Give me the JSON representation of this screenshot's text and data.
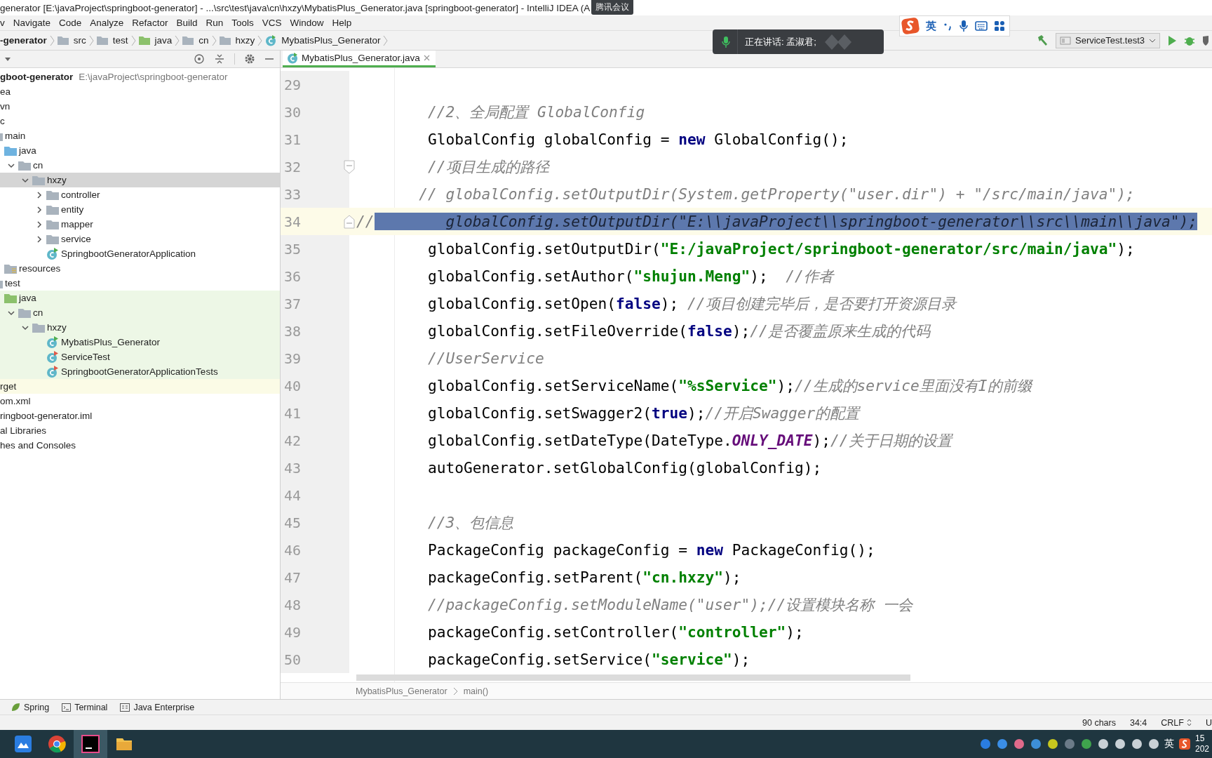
{
  "window": {
    "title": "generator [E:\\javaProject\\springboot-generator] - ...\\src\\test\\java\\cn\\hxzy\\MybatisPlus_Generator.java [springboot-generator] - IntelliJ IDEA (A",
    "overlay_badge": "腾讯会议"
  },
  "menu": [
    "v",
    "Navigate",
    "Code",
    "Analyze",
    "Refactor",
    "Build",
    "Run",
    "Tools",
    "VCS",
    "Window",
    "Help"
  ],
  "navigation_bar": {
    "items": [
      {
        "label": "-generator",
        "kind": "module"
      },
      {
        "label": "src",
        "kind": "folder"
      },
      {
        "label": "test",
        "kind": "folder"
      },
      {
        "label": "java",
        "kind": "test-root"
      },
      {
        "label": "cn",
        "kind": "package"
      },
      {
        "label": "hxzy",
        "kind": "package"
      },
      {
        "label": "MybatisPlus_Generator",
        "kind": "runnable-class"
      }
    ],
    "run_configuration": "ServiceTest.test3"
  },
  "meeting_toast": {
    "text": "正在讲话: 孟淑君;"
  },
  "input_method_bar": {
    "mode": "英"
  },
  "project_tree": {
    "items": [
      {
        "label": "gboot-generator",
        "path": "E:\\javaProject\\springboot-generator",
        "kind": "project",
        "selected": false,
        "children": [
          {
            "label": "ea",
            "kind": "folder",
            "selected": false
          },
          {
            "label": "vn",
            "kind": "folder",
            "selected": false
          },
          {
            "label": "c",
            "kind": "folder",
            "selected": false,
            "children": [
              {
                "label": "main",
                "kind": "folder",
                "selected": false,
                "children": [
                  {
                    "label": "java",
                    "kind": "source-root",
                    "selected": false,
                    "children": [
                      {
                        "label": "cn",
                        "kind": "package",
                        "expanded": true,
                        "selected": false,
                        "children": [
                          {
                            "label": "hxzy",
                            "kind": "package",
                            "expanded": true,
                            "selected": true,
                            "children": [
                              {
                                "label": "controller",
                                "kind": "package",
                                "expanded": false,
                                "selected": false
                              },
                              {
                                "label": "entity",
                                "kind": "package",
                                "expanded": false,
                                "selected": false
                              },
                              {
                                "label": "mapper",
                                "kind": "package",
                                "expanded": false,
                                "selected": false
                              },
                              {
                                "label": "service",
                                "kind": "package",
                                "expanded": false,
                                "selected": false
                              },
                              {
                                "label": "SpringbootGeneratorApplication",
                                "kind": "app-class",
                                "selected": false
                              }
                            ]
                          }
                        ]
                      }
                    ]
                  },
                  {
                    "label": "resources",
                    "kind": "resources-root",
                    "selected": false
                  }
                ]
              },
              {
                "label": "test",
                "kind": "folder",
                "selected": false,
                "children": [
                  {
                    "label": "java",
                    "kind": "test-root",
                    "selected": false,
                    "children": [
                      {
                        "label": "cn",
                        "kind": "package",
                        "expanded": true,
                        "selected": false,
                        "children": [
                          {
                            "label": "hxzy",
                            "kind": "package",
                            "expanded": true,
                            "selected": false,
                            "children": [
                              {
                                "label": "MybatisPlus_Generator",
                                "kind": "runnable-class",
                                "selected": false
                              },
                              {
                                "label": "ServiceTest",
                                "kind": "test-class",
                                "selected": false
                              },
                              {
                                "label": "SpringbootGeneratorApplicationTests",
                                "kind": "test-class",
                                "selected": false
                              }
                            ]
                          }
                        ]
                      }
                    ]
                  }
                ]
              }
            ]
          },
          {
            "label": "rget",
            "kind": "excluded-folder",
            "selected": false
          },
          {
            "label": "om.xml",
            "kind": "file",
            "selected": false
          },
          {
            "label": "ringboot-generator.iml",
            "kind": "file",
            "selected": false
          }
        ]
      },
      {
        "label": "al Libraries",
        "kind": "library",
        "selected": false
      },
      {
        "label": "hes and Consoles",
        "kind": "scratches",
        "selected": false
      }
    ]
  },
  "editor": {
    "tab": {
      "label": "MybatisPlus_Generator.java",
      "selected": true
    },
    "lines": [
      {
        "number": "29",
        "selected": false
      },
      {
        "number": "30",
        "selected": false,
        "segments": [
          {
            "text": "        //2、全局配置 GlobalConfig",
            "kind": "comment"
          }
        ]
      },
      {
        "number": "31",
        "selected": false,
        "segments": [
          {
            "text": "        GlobalConfig globalConfig = ",
            "kind": "plain"
          },
          {
            "text": "new",
            "kind": "keyword"
          },
          {
            "text": " GlobalConfig();",
            "kind": "plain"
          }
        ]
      },
      {
        "number": "32",
        "selected": false,
        "fold_start": true,
        "segments": [
          {
            "text": "        //项目生成的路径",
            "kind": "comment"
          }
        ]
      },
      {
        "number": "33",
        "selected": false,
        "segments": [
          {
            "text": "       // globalConfig.setOutputDir(System.getProperty(\"user.dir\") + \"/src/main/java\");",
            "kind": "comment"
          }
        ]
      },
      {
        "number": "34",
        "selected": true,
        "fold_end": true,
        "segments": [
          {
            "text": "//",
            "kind": "comment"
          },
          {
            "text": "        globalConfig.setOutputDir(\"E:\\\\javaProject\\\\springboot-generator\\\\src\\\\main\\\\java\");",
            "kind": "comment"
          }
        ]
      },
      {
        "number": "35",
        "selected": false,
        "segments": [
          {
            "text": "        globalConfig.setOutputDir(",
            "kind": "plain"
          },
          {
            "text": "\"E:/javaProject/springboot-generator/src/main/java\"",
            "kind": "string"
          },
          {
            "text": ");",
            "kind": "plain"
          }
        ]
      },
      {
        "number": "36",
        "selected": false,
        "segments": [
          {
            "text": "        globalConfig.setAuthor(",
            "kind": "plain"
          },
          {
            "text": "\"shujun.Meng\"",
            "kind": "string"
          },
          {
            "text": ");  ",
            "kind": "plain"
          },
          {
            "text": "//作者",
            "kind": "comment"
          }
        ]
      },
      {
        "number": "37",
        "selected": false,
        "segments": [
          {
            "text": "        globalConfig.setOpen(",
            "kind": "plain"
          },
          {
            "text": "false",
            "kind": "keyword"
          },
          {
            "text": "); ",
            "kind": "plain"
          },
          {
            "text": "//项目创建完毕后，是否要打开资源目录",
            "kind": "comment"
          }
        ]
      },
      {
        "number": "38",
        "selected": false,
        "segments": [
          {
            "text": "        globalConfig.setFileOverride(",
            "kind": "plain"
          },
          {
            "text": "false",
            "kind": "keyword"
          },
          {
            "text": ");",
            "kind": "plain"
          },
          {
            "text": "//是否覆盖原来生成的代码",
            "kind": "comment"
          }
        ]
      },
      {
        "number": "39",
        "selected": false,
        "segments": [
          {
            "text": "        //UserService",
            "kind": "comment"
          }
        ]
      },
      {
        "number": "40",
        "selected": false,
        "segments": [
          {
            "text": "        globalConfig.setServiceName(",
            "kind": "plain"
          },
          {
            "text": "\"%sService\"",
            "kind": "string"
          },
          {
            "text": ");",
            "kind": "plain"
          },
          {
            "text": "//生成的service里面没有I的前缀",
            "kind": "comment"
          }
        ]
      },
      {
        "number": "41",
        "selected": false,
        "segments": [
          {
            "text": "        globalConfig.setSwagger2(",
            "kind": "plain"
          },
          {
            "text": "true",
            "kind": "keyword"
          },
          {
            "text": ");",
            "kind": "plain"
          },
          {
            "text": "//开启Swagger的配置",
            "kind": "comment"
          }
        ]
      },
      {
        "number": "42",
        "selected": false,
        "segments": [
          {
            "text": "        globalConfig.setDateType(DateType.",
            "kind": "plain"
          },
          {
            "text": "ONLY_DATE",
            "kind": "constant"
          },
          {
            "text": ");",
            "kind": "plain"
          },
          {
            "text": "//关于日期的设置",
            "kind": "comment"
          }
        ]
      },
      {
        "number": "43",
        "selected": false,
        "segments": [
          {
            "text": "        autoGenerator.setGlobalConfig(globalConfig);",
            "kind": "plain"
          }
        ]
      },
      {
        "number": "44",
        "selected": false
      },
      {
        "number": "45",
        "selected": false,
        "segments": [
          {
            "text": "        //3、包信息",
            "kind": "comment"
          }
        ]
      },
      {
        "number": "46",
        "selected": false,
        "segments": [
          {
            "text": "        PackageConfig packageConfig = ",
            "kind": "plain"
          },
          {
            "text": "new",
            "kind": "keyword"
          },
          {
            "text": " PackageConfig();",
            "kind": "plain"
          }
        ]
      },
      {
        "number": "47",
        "selected": false,
        "segments": [
          {
            "text": "        packageConfig.setParent(",
            "kind": "plain"
          },
          {
            "text": "\"cn.hxzy\"",
            "kind": "string"
          },
          {
            "text": ");",
            "kind": "plain"
          }
        ]
      },
      {
        "number": "48",
        "selected": false,
        "segments": [
          {
            "text": "        //packageConfig.setModuleName(\"user\");//设置模块名称 一会",
            "kind": "comment"
          }
        ]
      },
      {
        "number": "49",
        "selected": false,
        "segments": [
          {
            "text": "        packageConfig.setController(",
            "kind": "plain"
          },
          {
            "text": "\"controller\"",
            "kind": "string"
          },
          {
            "text": ");",
            "kind": "plain"
          }
        ]
      },
      {
        "number": "50",
        "selected": false,
        "segments": [
          {
            "text": "        packageConfig.setService(",
            "kind": "plain"
          },
          {
            "text": "\"service\"",
            "kind": "string"
          },
          {
            "text": ");",
            "kind": "plain"
          }
        ]
      }
    ],
    "breadcrumb": [
      "MybatisPlus_Generator",
      "main()"
    ]
  },
  "tool_windows": [
    {
      "label": "Spring",
      "kind": "spring"
    },
    {
      "label": "Terminal",
      "kind": "terminal"
    },
    {
      "label": "Java Enterprise",
      "kind": "enterprise"
    }
  ],
  "status_bar": {
    "chars": "90 chars",
    "position": "34:4",
    "line_separator": "CRLF",
    "encoding": "U"
  },
  "taskbar": {
    "input_language": "英",
    "clock_time": "15",
    "clock_date": "202"
  }
}
